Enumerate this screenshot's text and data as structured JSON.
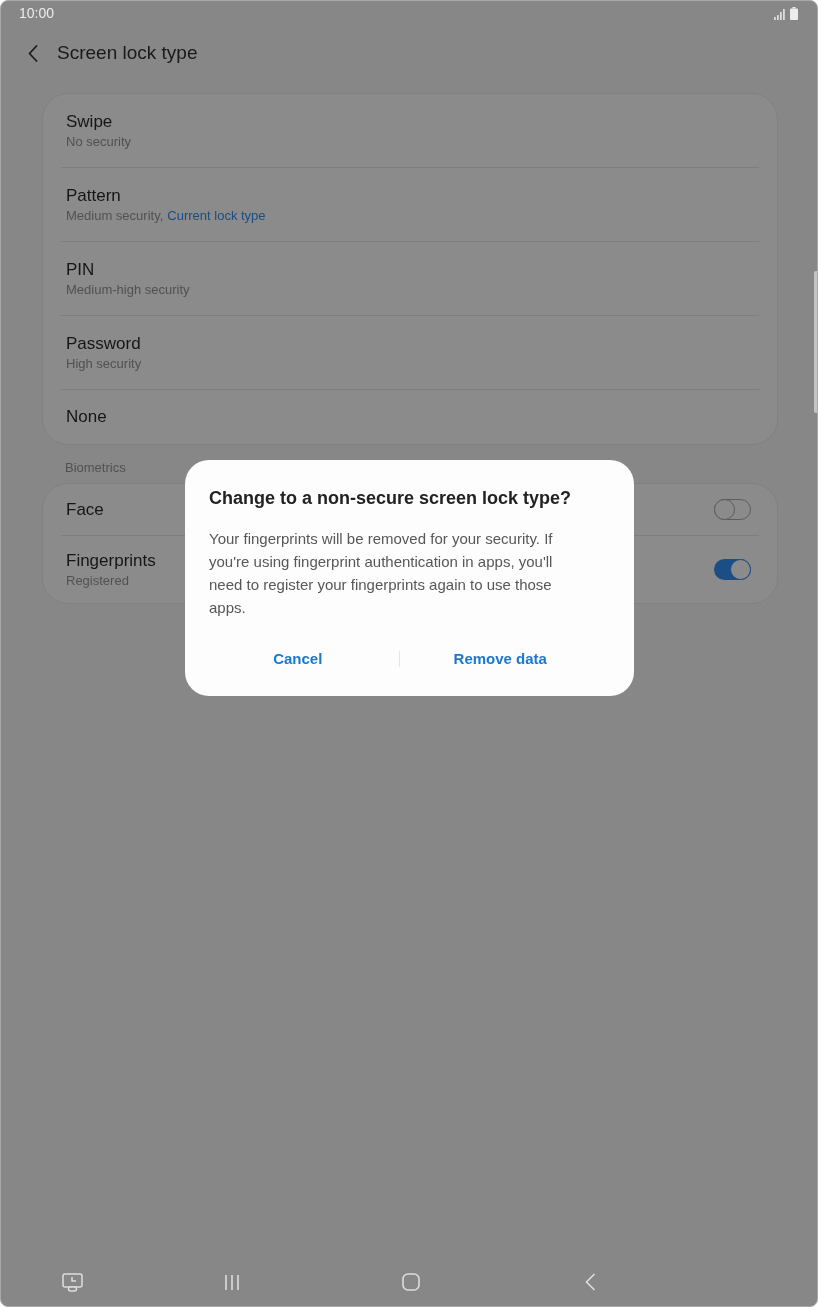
{
  "status_bar": {
    "time": "10:00"
  },
  "header": {
    "title": "Screen lock type"
  },
  "lock_types": [
    {
      "title": "Swipe",
      "subtitle": "No security"
    },
    {
      "title": "Pattern",
      "subtitle": "Medium security,",
      "current_label": "Current lock type"
    },
    {
      "title": "PIN",
      "subtitle": "Medium-high security"
    },
    {
      "title": "Password",
      "subtitle": "High security"
    },
    {
      "title": "None"
    }
  ],
  "biometrics": {
    "heading": "Biometrics",
    "items": [
      {
        "title": "Face",
        "on": false
      },
      {
        "title": "Fingerprints",
        "subtitle": "Registered",
        "on": true
      }
    ]
  },
  "dialog": {
    "title": "Change to a non-secure screen lock type?",
    "message": "Your fingerprints will be removed for your security. If you're using fingerprint authentication in apps, you'll need to register your fingerprints again to use those apps.",
    "buttons": [
      {
        "label": "Cancel"
      },
      {
        "label": "Remove data"
      }
    ]
  }
}
